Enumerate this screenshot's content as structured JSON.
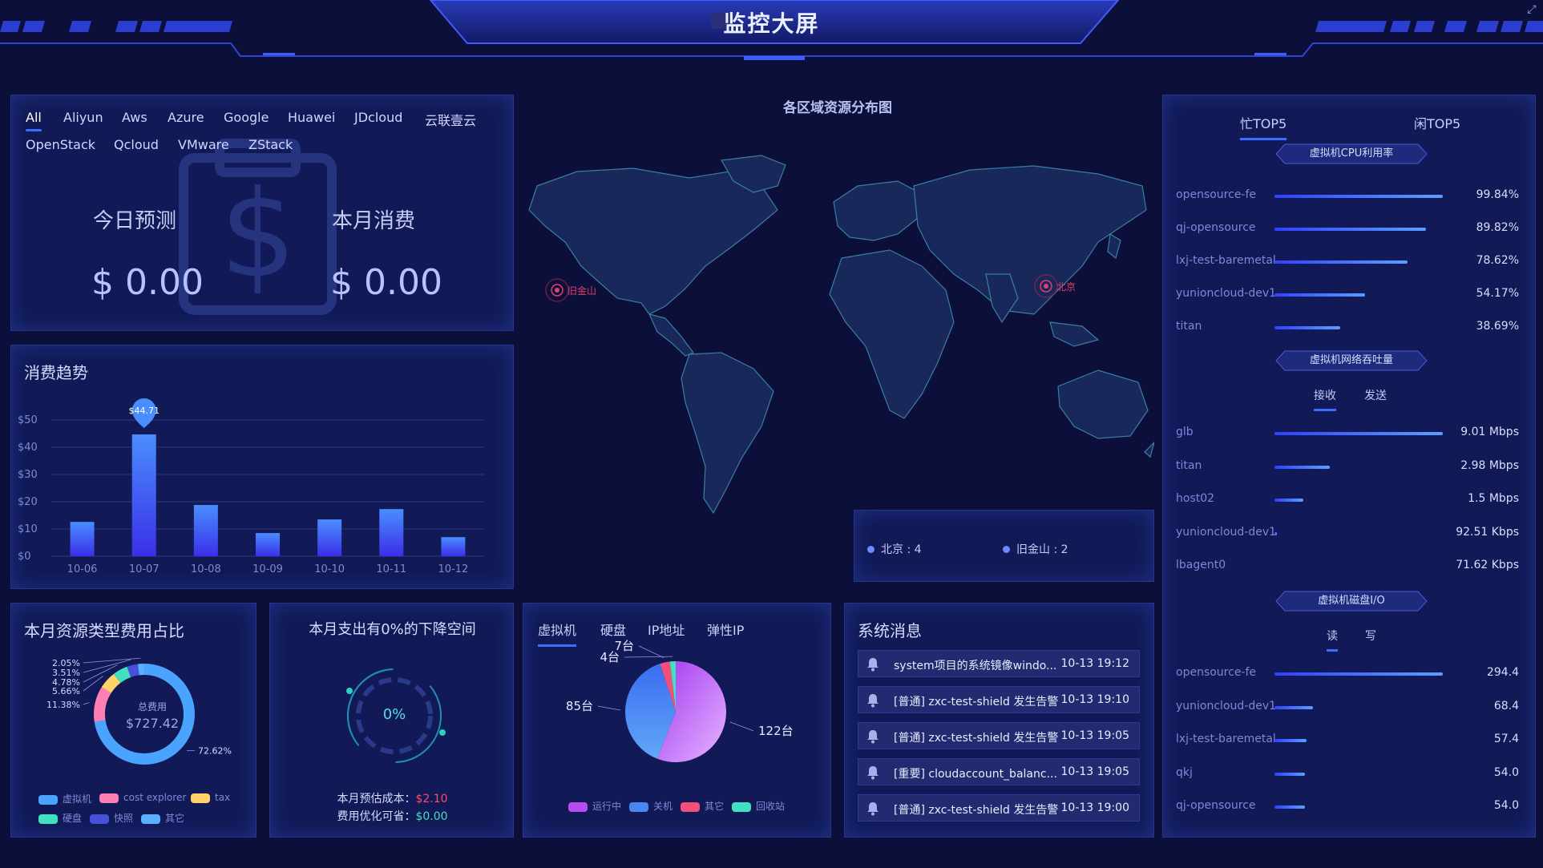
{
  "header": {
    "title": "监控大屏"
  },
  "cost_panel": {
    "cloud_tabs": [
      "All",
      "Aliyun",
      "Aws",
      "Azure",
      "Google",
      "Huawei",
      "JDcloud",
      "云联壹云",
      "OpenStack",
      "Qcloud",
      "VMware",
      "ZStack"
    ],
    "active_tab": "All",
    "today_label": "今日预测",
    "today_value": "$ 0.00",
    "month_label": "本月消费",
    "month_value": "$ 0.00"
  },
  "map_panel": {
    "title": "各区域资源分布图",
    "markers": [
      {
        "label": "旧金山"
      },
      {
        "label": "北京"
      }
    ],
    "legend": [
      {
        "label": "北京 : 4"
      },
      {
        "label": "旧金山 : 2"
      }
    ]
  },
  "trend_panel": {
    "title": "消费趋势",
    "tooltip": "$44.71",
    "chart_data": {
      "type": "bar",
      "categories": [
        "10-06",
        "10-07",
        "10-08",
        "10-09",
        "10-10",
        "10-11",
        "10-12"
      ],
      "values": [
        12.6,
        44.71,
        18.8,
        8.5,
        13.5,
        17.3,
        7.0
      ],
      "y_ticks": [
        "$0",
        "$10",
        "$20",
        "$30",
        "$40",
        "$50"
      ],
      "ylim": [
        0,
        50
      ],
      "grid": true
    }
  },
  "type_ratio_panel": {
    "title": "本月资源类型费用占比",
    "center_label": "总费用",
    "center_value": "$727.42",
    "chart_data": {
      "type": "pie",
      "labels": [
        "虚拟机",
        "cost explorer",
        "tax",
        "硬盘",
        "快照",
        "其它"
      ],
      "values": [
        72.62,
        11.38,
        5.66,
        4.78,
        3.51,
        2.05
      ],
      "value_labels": [
        "72.62%",
        "11.38%",
        "5.66%",
        "4.78%",
        "3.51%",
        "2.05%"
      ],
      "colors": [
        "#4aa3ff",
        "#ff7eb3",
        "#ffd36a",
        "#40e0c0",
        "#4650d8",
        "#5ab0ff"
      ]
    },
    "legend": [
      "虚拟机",
      "cost explorer",
      "tax",
      "硬盘",
      "快照",
      "其它"
    ]
  },
  "saving_panel": {
    "title": "本月支出有0%的下降空间",
    "gauge_value": "0%",
    "estimated_label": "本月预估成本：",
    "estimated_value": "$2.10",
    "optimizable_label": "费用优化可省：",
    "optimizable_value": "$0.00"
  },
  "resource_panel": {
    "tabs": [
      "虚拟机",
      "硬盘",
      "IP地址",
      "弹性IP"
    ],
    "active_tab": "虚拟机",
    "chart_data": {
      "type": "pie",
      "labels": [
        "运行中",
        "关机",
        "其它",
        "回收站"
      ],
      "values": [
        122,
        85,
        7,
        4
      ],
      "value_labels": [
        "122台",
        "85台",
        "7台",
        "4台"
      ],
      "colors": [
        "#b44ef0",
        "#4a86f0",
        "#f0507a",
        "#40e0c0"
      ]
    },
    "legend": [
      "运行中",
      "关机",
      "其它",
      "回收站"
    ]
  },
  "messages_panel": {
    "title": "系统消息",
    "items": [
      {
        "text": "system项目的系统镜像windo...",
        "time": "10-13 19:12"
      },
      {
        "text": "[普通] zxc-test-shield 发生告警",
        "time": "10-13 19:10"
      },
      {
        "text": "[普通] zxc-test-shield 发生告警",
        "time": "10-13 19:05"
      },
      {
        "text": "[重要] cloudaccount_balanc...",
        "time": "10-13 19:05"
      },
      {
        "text": "[普通] zxc-test-shield 发生告警",
        "time": "10-13 19:00"
      }
    ]
  },
  "top_panel": {
    "tabs": [
      "忙TOP5",
      "闲TOP5"
    ],
    "active_tab": "忙TOP5",
    "cpu": {
      "title": "虚拟机CPU利用率",
      "items": [
        {
          "name": "opensource-fe",
          "value": "99.84%",
          "ratio": 1.0
        },
        {
          "name": "qj-opensource",
          "value": "89.82%",
          "ratio": 0.9
        },
        {
          "name": "lxj-test-baremetal",
          "value": "78.62%",
          "ratio": 0.79
        },
        {
          "name": "yunioncloud-dev1",
          "value": "54.17%",
          "ratio": 0.54
        },
        {
          "name": "titan",
          "value": "38.69%",
          "ratio": 0.39
        }
      ]
    },
    "network": {
      "title": "虚拟机网络吞吐量",
      "sub_tabs": [
        "接收",
        "发送"
      ],
      "active_sub": "接收",
      "items": [
        {
          "name": "glb",
          "value": "9.01 Mbps",
          "ratio": 1.0
        },
        {
          "name": "titan",
          "value": "2.98 Mbps",
          "ratio": 0.33
        },
        {
          "name": "host02",
          "value": "1.5 Mbps",
          "ratio": 0.17
        },
        {
          "name": "yunioncloud-dev1",
          "value": "92.51 Kbps",
          "ratio": 0.01
        },
        {
          "name": "lbagent0",
          "value": "71.62 Kbps",
          "ratio": 0.0
        }
      ]
    },
    "disk": {
      "title": "虚拟机磁盘I/O",
      "sub_tabs": [
        "读",
        "写"
      ],
      "active_sub": "读",
      "items": [
        {
          "name": "opensource-fe",
          "value": "294.4",
          "ratio": 1.0
        },
        {
          "name": "yunioncloud-dev1",
          "value": "68.4",
          "ratio": 0.23
        },
        {
          "name": "lxj-test-baremetal",
          "value": "57.4",
          "ratio": 0.19
        },
        {
          "name": "qkj",
          "value": "54.0",
          "ratio": 0.18
        },
        {
          "name": "qj-opensource",
          "value": "54.0",
          "ratio": 0.18
        }
      ]
    }
  }
}
